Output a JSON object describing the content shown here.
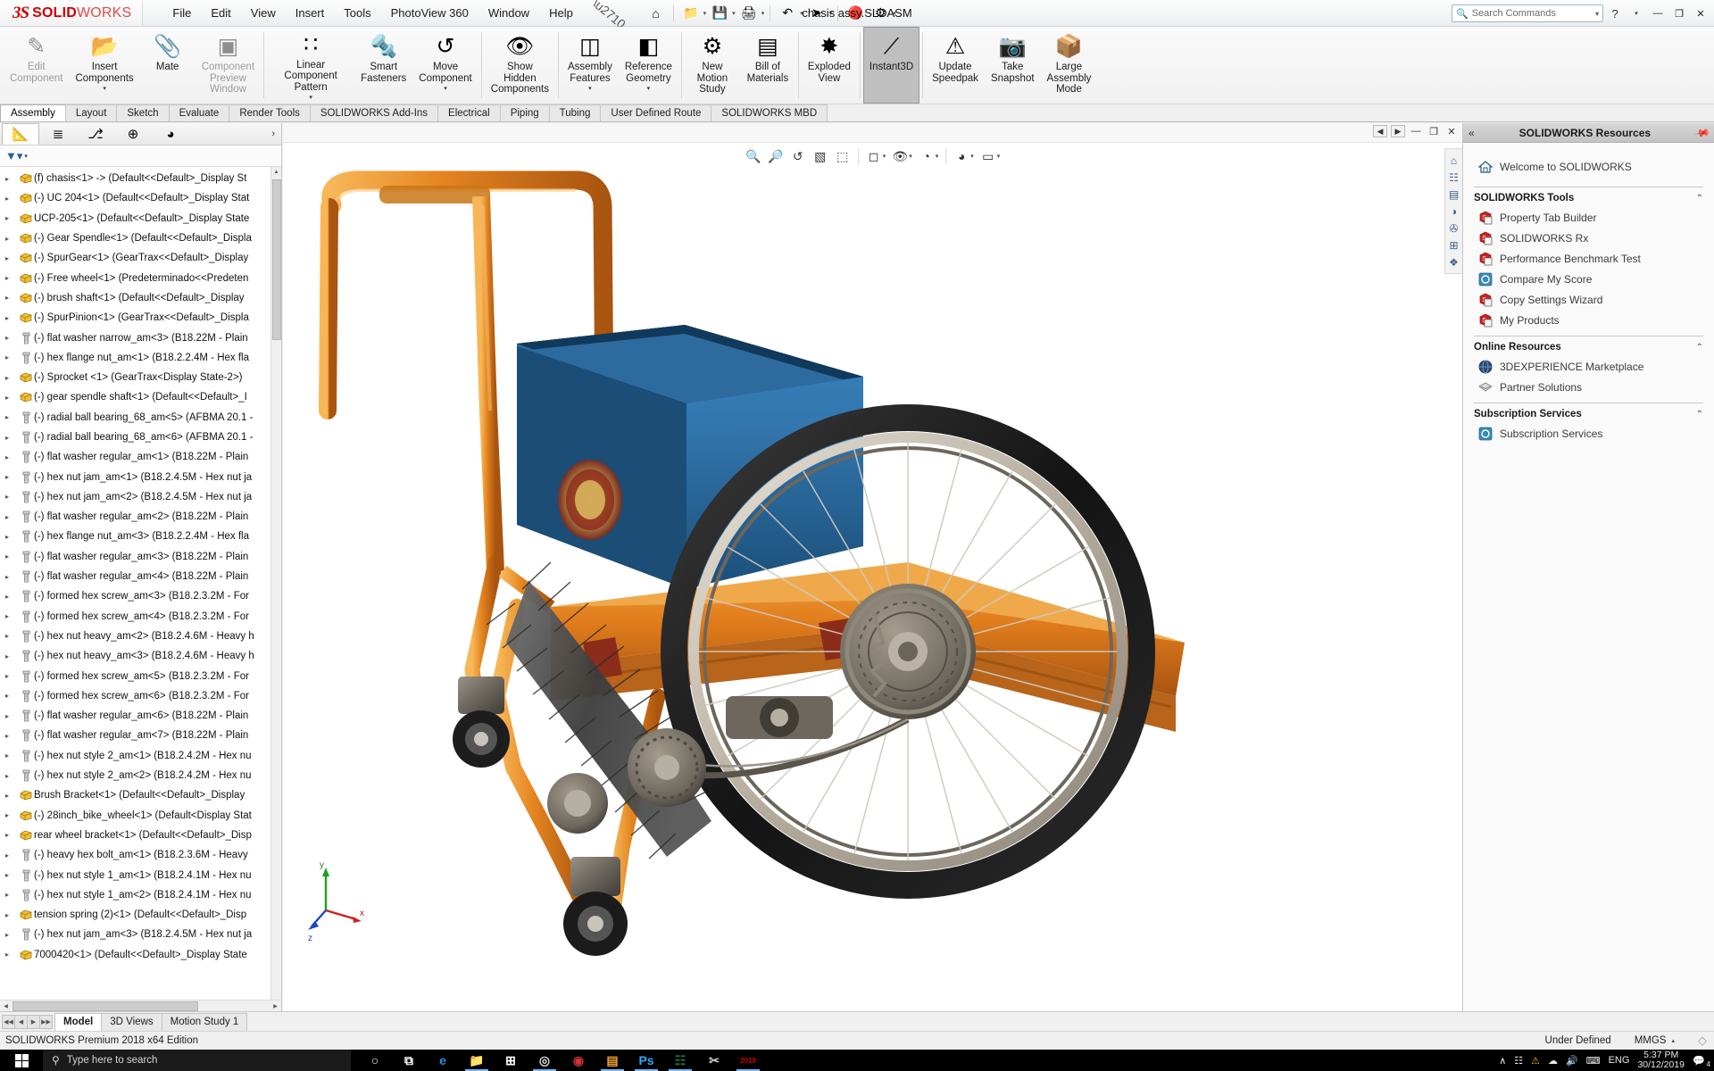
{
  "window": {
    "brand_mark": "3S",
    "brand_text_bold": "SOLID",
    "brand_text_light": "WORKS",
    "document_title": "chasis assy.SLDASM",
    "minimize": "—",
    "maximize": "❐",
    "close": "✕",
    "help_icon": "?",
    "help_caret": "▾"
  },
  "menu": {
    "items": [
      "File",
      "Edit",
      "View",
      "Insert",
      "Tools",
      "PhotoView 360",
      "Window",
      "Help"
    ],
    "pin_icon": "pin-icon"
  },
  "quick_access": [
    {
      "name": "new-document-icon",
      "glyph": "⌂",
      "caret": false
    },
    {
      "name": "open-document-icon",
      "glyph": "📁",
      "caret": true
    },
    {
      "name": "save-icon",
      "glyph": "💾",
      "caret": true
    },
    {
      "name": "print-icon",
      "glyph": "🖨",
      "caret": true
    },
    {
      "name": "undo-icon",
      "glyph": "↶",
      "caret": true
    },
    {
      "name": "select-icon",
      "glyph": "➤",
      "caret": true
    },
    {
      "name": "rebuild-icon",
      "glyph": "🔴",
      "caret": false
    },
    {
      "name": "options-icon",
      "glyph": "⚙",
      "caret": true
    }
  ],
  "search": {
    "placeholder": "Search Commands",
    "icon": "search-icon",
    "dropdown_caret": "▾"
  },
  "ribbon": {
    "commands": [
      {
        "label": "Edit\nComponent",
        "icon": "edit-component-icon",
        "glyph": "✎",
        "state": "disabled",
        "caret": false
      },
      {
        "label": "Insert\nComponents",
        "icon": "insert-components-icon",
        "glyph": "📂",
        "state": "normal",
        "caret": true
      },
      {
        "label": "Mate",
        "icon": "mate-icon",
        "glyph": "📎",
        "state": "normal",
        "caret": false
      },
      {
        "label": "Component\nPreview\nWindow",
        "icon": "component-preview-icon",
        "glyph": "▣",
        "state": "disabled",
        "caret": false
      },
      {
        "label": "Linear Component\nPattern",
        "icon": "linear-component-pattern-icon",
        "glyph": "∷",
        "state": "normal",
        "caret": true
      },
      {
        "label": "Smart\nFasteners",
        "icon": "smart-fasteners-icon",
        "glyph": "🔩",
        "state": "normal",
        "caret": false
      },
      {
        "label": "Move\nComponent",
        "icon": "move-component-icon",
        "glyph": "↺",
        "state": "normal",
        "caret": true
      },
      {
        "label": "Show\nHidden\nComponents",
        "icon": "show-hidden-components-icon",
        "glyph": "👁",
        "state": "normal",
        "caret": false
      },
      {
        "label": "Assembly\nFeatures",
        "icon": "assembly-features-icon",
        "glyph": "◫",
        "state": "normal",
        "caret": true
      },
      {
        "label": "Reference\nGeometry",
        "icon": "reference-geometry-icon",
        "glyph": "◧",
        "state": "normal",
        "caret": true
      },
      {
        "label": "New\nMotion\nStudy",
        "icon": "new-motion-study-icon",
        "glyph": "⚙",
        "state": "normal",
        "caret": false
      },
      {
        "label": "Bill of\nMaterials",
        "icon": "bill-of-materials-icon",
        "glyph": "▤",
        "state": "normal",
        "caret": false
      },
      {
        "label": "Exploded\nView",
        "icon": "exploded-view-icon",
        "glyph": "✸",
        "state": "normal",
        "caret": false
      },
      {
        "label": "Instant3D",
        "icon": "instant3d-icon",
        "glyph": "⟋",
        "state": "active",
        "caret": false
      },
      {
        "label": "Update\nSpeedpak",
        "icon": "update-speedpak-icon",
        "glyph": "⚠",
        "state": "normal",
        "caret": false
      },
      {
        "label": "Take\nSnapshot",
        "icon": "take-snapshot-icon",
        "glyph": "📷",
        "state": "normal",
        "caret": false
      },
      {
        "label": "Large\nAssembly\nMode",
        "icon": "large-assembly-mode-icon",
        "glyph": "📦",
        "state": "normal",
        "caret": false
      }
    ],
    "tabs": [
      {
        "label": "Assembly",
        "selected": true
      },
      {
        "label": "Layout",
        "selected": false
      },
      {
        "label": "Sketch",
        "selected": false
      },
      {
        "label": "Evaluate",
        "selected": false
      },
      {
        "label": "Render Tools",
        "selected": false
      },
      {
        "label": "SOLIDWORKS Add-Ins",
        "selected": false
      },
      {
        "label": "Electrical",
        "selected": false
      },
      {
        "label": "Piping",
        "selected": false
      },
      {
        "label": "Tubing",
        "selected": false
      },
      {
        "label": "User Defined Route",
        "selected": false
      },
      {
        "label": "SOLIDWORKS MBD",
        "selected": false
      }
    ]
  },
  "tree_panel": {
    "tabs": [
      {
        "name": "feature-manager-tab",
        "glyph": "📐",
        "selected": true
      },
      {
        "name": "property-manager-tab",
        "glyph": "≣",
        "selected": false
      },
      {
        "name": "configuration-manager-tab",
        "glyph": "⎇",
        "selected": false
      },
      {
        "name": "dimxpert-manager-tab",
        "glyph": "⊕",
        "selected": false
      },
      {
        "name": "display-manager-tab",
        "glyph": "◕",
        "selected": false
      }
    ],
    "expand_chevron": "›",
    "filter_icon": "filter-icon",
    "filter_caret": "▾",
    "items": [
      {
        "name": "(f) chasis<1> -> (Default<<Default>_Display St",
        "type": "part"
      },
      {
        "name": "(-) UC 204<1> (Default<<Default>_Display Stat",
        "type": "part"
      },
      {
        "name": "UCP-205<1> (Default<<Default>_Display State",
        "type": "part"
      },
      {
        "name": "(-) Gear Spendle<1> (Default<<Default>_Displa",
        "type": "part"
      },
      {
        "name": "(-) SpurGear<1> (GearTrax<<Default>_Display",
        "type": "part"
      },
      {
        "name": "(-) Free wheel<1> (Predeterminado<<Predeten",
        "type": "part"
      },
      {
        "name": "(-) brush shaft<1> (Default<<Default>_Display",
        "type": "part"
      },
      {
        "name": "(-) SpurPinion<1> (GearTrax<<Default>_Displa",
        "type": "part"
      },
      {
        "name": "(-) flat washer narrow_am<3> (B18.22M - Plain",
        "type": "bolt"
      },
      {
        "name": "(-) hex flange nut_am<1> (B18.2.2.4M - Hex fla",
        "type": "bolt"
      },
      {
        "name": "(-) Sprocket <1> (GearTrax<Display State-2>)",
        "type": "part"
      },
      {
        "name": "(-) gear spendle shaft<1> (Default<<Default>_I",
        "type": "part"
      },
      {
        "name": "(-) radial ball bearing_68_am<5> (AFBMA 20.1 -",
        "type": "bolt"
      },
      {
        "name": "(-) radial ball bearing_68_am<6> (AFBMA 20.1 -",
        "type": "bolt"
      },
      {
        "name": "(-) flat washer regular_am<1> (B18.22M - Plain",
        "type": "bolt"
      },
      {
        "name": "(-) hex nut jam_am<1> (B18.2.4.5M - Hex nut ja",
        "type": "bolt"
      },
      {
        "name": "(-) hex nut jam_am<2> (B18.2.4.5M - Hex nut ja",
        "type": "bolt"
      },
      {
        "name": "(-) flat washer regular_am<2> (B18.22M - Plain",
        "type": "bolt"
      },
      {
        "name": "(-) hex flange nut_am<3> (B18.2.2.4M - Hex fla",
        "type": "bolt"
      },
      {
        "name": "(-) flat washer regular_am<3> (B18.22M - Plain",
        "type": "bolt"
      },
      {
        "name": "(-) flat washer regular_am<4> (B18.22M - Plain",
        "type": "bolt"
      },
      {
        "name": "(-) formed hex screw_am<3> (B18.2.3.2M - For",
        "type": "bolt"
      },
      {
        "name": "(-) formed hex screw_am<4> (B18.2.3.2M - For",
        "type": "bolt"
      },
      {
        "name": "(-) hex nut heavy_am<2> (B18.2.4.6M - Heavy h",
        "type": "bolt"
      },
      {
        "name": "(-) hex nut heavy_am<3> (B18.2.4.6M - Heavy h",
        "type": "bolt"
      },
      {
        "name": "(-) formed hex screw_am<5> (B18.2.3.2M - For",
        "type": "bolt"
      },
      {
        "name": "(-) formed hex screw_am<6> (B18.2.3.2M - For",
        "type": "bolt"
      },
      {
        "name": "(-) flat washer regular_am<6> (B18.22M - Plain",
        "type": "bolt"
      },
      {
        "name": "(-) flat washer regular_am<7> (B18.22M - Plain",
        "type": "bolt"
      },
      {
        "name": "(-) hex nut style 2_am<1> (B18.2.4.2M - Hex nu",
        "type": "bolt"
      },
      {
        "name": "(-) hex nut style 2_am<2> (B18.2.4.2M - Hex nu",
        "type": "bolt"
      },
      {
        "name": "Brush Bracket<1> (Default<<Default>_Display",
        "type": "part"
      },
      {
        "name": "(-) 28inch_bike_wheel<1> (Default<Display Stat",
        "type": "part"
      },
      {
        "name": "rear wheel bracket<1> (Default<<Default>_Disp",
        "type": "part"
      },
      {
        "name": "(-) heavy hex bolt_am<1> (B18.2.3.6M - Heavy",
        "type": "bolt"
      },
      {
        "name": "(-) hex nut style 1_am<1> (B18.2.4.1M - Hex nu",
        "type": "bolt"
      },
      {
        "name": "(-) hex nut style 1_am<2> (B18.2.4.1M - Hex nu",
        "type": "bolt"
      },
      {
        "name": "tension spring (2)<1> (Default<<Default>_Disp",
        "type": "part"
      },
      {
        "name": "(-) hex nut jam_am<3> (B18.2.4.5M - Hex nut ja",
        "type": "bolt"
      },
      {
        "name": "7000420<1> (Default<<Default>_Display State",
        "type": "part"
      }
    ]
  },
  "graphics": {
    "window_buttons": {
      "prev": "◀",
      "next": "▶",
      "minimize": "—",
      "restore": "❐",
      "close": "✕"
    },
    "view_toolbar": [
      {
        "name": "zoom-to-fit-icon",
        "glyph": "🔍",
        "caret": false
      },
      {
        "name": "zoom-to-area-icon",
        "glyph": "🔎",
        "caret": false
      },
      {
        "name": "previous-view-icon",
        "glyph": "↺",
        "caret": false
      },
      {
        "name": "section-view-icon",
        "glyph": "▧",
        "caret": false
      },
      {
        "name": "view-orientation-icon",
        "glyph": "⬚",
        "caret": false
      },
      {
        "name": "display-style-icon",
        "glyph": "◻",
        "caret": true
      },
      {
        "name": "hide-show-items-icon",
        "glyph": "👁",
        "caret": true
      },
      {
        "name": "edit-appearance-icon",
        "glyph": "◔",
        "caret": true
      },
      {
        "name": "apply-scene-icon",
        "glyph": "◕",
        "caret": true
      },
      {
        "name": "view-settings-icon",
        "glyph": "▭",
        "caret": true
      }
    ],
    "dock_icons": [
      {
        "name": "view-home-icon",
        "glyph": "⌂"
      },
      {
        "name": "view-palette-icon",
        "glyph": "☷"
      },
      {
        "name": "appearances-icon",
        "glyph": "▤"
      },
      {
        "name": "scenes-icon",
        "glyph": "◑"
      },
      {
        "name": "decals-icon",
        "glyph": "✇"
      },
      {
        "name": "custom-view-icon",
        "glyph": "⊞"
      },
      {
        "name": "display-states-icon",
        "glyph": "❖"
      }
    ],
    "triad_labels": {
      "x": "x",
      "y": "y",
      "z": "z"
    }
  },
  "task_pane": {
    "collapse_icon": "«",
    "title": "SOLIDWORKS Resources",
    "pin_icon": "pin-icon",
    "welcome": {
      "label": "Welcome to SOLIDWORKS",
      "icon": "home-icon"
    },
    "groups": [
      {
        "title": "SOLIDWORKS Tools",
        "chevron": "ⱏ",
        "items": [
          {
            "label": "Property Tab Builder",
            "icon": "property-tab-builder-icon"
          },
          {
            "label": "SOLIDWORKS Rx",
            "icon": "solidworks-rx-icon"
          },
          {
            "label": "Performance Benchmark Test",
            "icon": "performance-benchmark-icon"
          },
          {
            "label": "Compare My Score",
            "icon": "compare-my-score-icon"
          },
          {
            "label": "Copy Settings Wizard",
            "icon": "copy-settings-wizard-icon"
          },
          {
            "label": "My Products",
            "icon": "my-products-icon"
          }
        ]
      },
      {
        "title": "Online Resources",
        "chevron": "ⱏ",
        "items": [
          {
            "label": "3DEXPERIENCE Marketplace",
            "icon": "3dexperience-marketplace-icon"
          },
          {
            "label": "Partner Solutions",
            "icon": "partner-solutions-icon"
          }
        ]
      },
      {
        "title": "Subscription Services",
        "chevron": "ⱏ",
        "items": [
          {
            "label": "Subscription Services",
            "icon": "subscription-services-icon"
          }
        ]
      }
    ]
  },
  "bottom_tabs": {
    "tabs": [
      {
        "label": "Model",
        "selected": true
      },
      {
        "label": "3D Views",
        "selected": false
      },
      {
        "label": "Motion Study 1",
        "selected": false
      }
    ]
  },
  "status_bar": {
    "edition": "SOLIDWORKS Premium 2018 x64 Edition",
    "state": "Under Defined",
    "units": "MMGS",
    "units_caret": "▴",
    "logo_icon": "solidworks-status-icon"
  },
  "taskbar": {
    "start_icon": "windows-start-icon",
    "search_placeholder": "Type here to search",
    "search_icon": "search-icon",
    "apps": [
      {
        "name": "cortana-icon",
        "glyph": "○",
        "color": "#ffffff",
        "open": false
      },
      {
        "name": "task-view-icon",
        "glyph": "⧉",
        "color": "#ffffff",
        "open": false
      },
      {
        "name": "edge-icon",
        "glyph": "e",
        "color": "#2b8ede",
        "open": false
      },
      {
        "name": "file-explorer-icon",
        "glyph": "📁",
        "color": "#f6c councils",
        "open": true
      },
      {
        "name": "microsoft-store-icon",
        "glyph": "⊞",
        "color": "#ffffff",
        "open": false
      },
      {
        "name": "chrome-icon",
        "glyph": "◎",
        "color": "#dddddd",
        "open": true
      },
      {
        "name": "antivirus-icon",
        "glyph": "◉",
        "color": "#cc3333",
        "open": false
      },
      {
        "name": "notepad-icon",
        "glyph": "▤",
        "color": "#f0a030",
        "open": true
      },
      {
        "name": "photoshop-icon",
        "glyph": "Ps",
        "color": "#31a8ff",
        "open": true
      },
      {
        "name": "excel-icon",
        "glyph": "☷",
        "color": "#1f7244",
        "open": true
      },
      {
        "name": "tool-icon",
        "glyph": "✂",
        "color": "#cccccc",
        "open": false
      },
      {
        "name": "solidworks-taskbar-icon",
        "glyph": "2018",
        "color": "#cc0000",
        "open": true
      }
    ],
    "tray": {
      "overflow": "∧",
      "network_icon": "network-icon",
      "security_icon": "security-icon",
      "onedrive_icon": "onedrive-icon",
      "volume_icon": "volume-icon",
      "keyboard_icon": "keyboard-icon",
      "language": "ENG",
      "time": "5:37 PM",
      "date": "30/12/2019",
      "notifications_icon": "notifications-icon",
      "notification_count": "4"
    }
  }
}
